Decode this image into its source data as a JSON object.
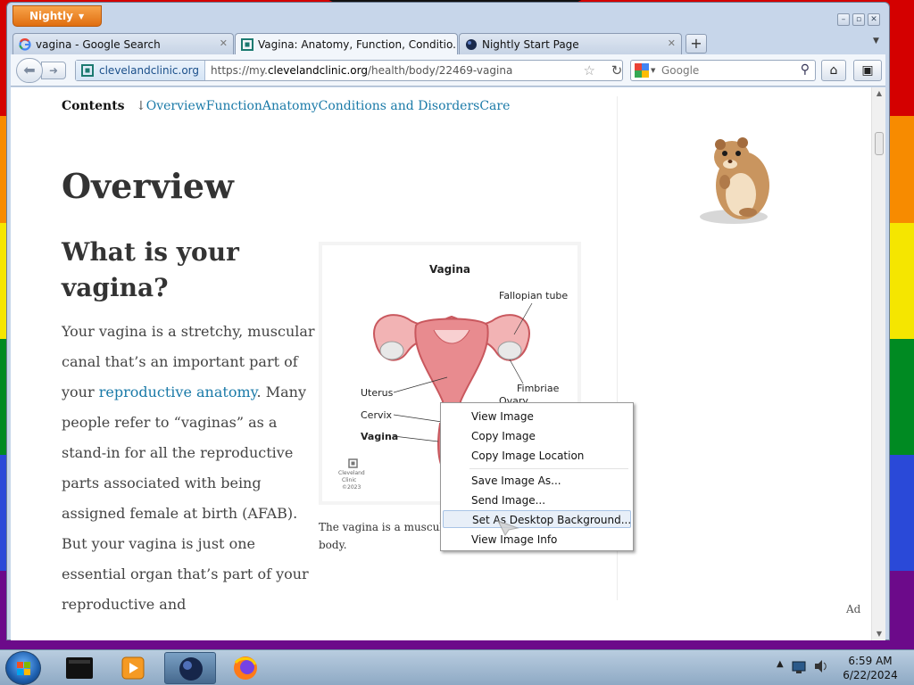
{
  "app": {
    "menu_button": "Nightly"
  },
  "tabs": [
    {
      "label": "vagina - Google Search",
      "close": "✕"
    },
    {
      "label": "Vagina: Anatomy, Function, Conditio...",
      "close": "✕"
    },
    {
      "label": "Nightly Start Page",
      "close": "✕"
    }
  ],
  "newtab_label": "+",
  "navbar": {
    "identity": "clevelandclinic.org",
    "url_prefix": "https://my.",
    "url_host": "clevelandclinic.org",
    "url_path": "/health/body/22469-vagina",
    "search_placeholder": "Google"
  },
  "page": {
    "contents_label": "Contents",
    "contents_arrow": "↓",
    "contents_links": [
      "Overview",
      "Function",
      "Anatomy",
      "Conditions and Disorders",
      "Care"
    ],
    "h1": "Overview",
    "h2": "What is your vagina?",
    "para_before": "Your vagina is a stretchy, muscular canal that’s an important part of your ",
    "para_link": "reproductive anatomy",
    "para_after": ". Many people refer to “vaginas” as a stand-in for all the reproductive parts associated with being assigned female at birth (AFAB). But your vagina is just one essential organ that’s part of your reproductive and",
    "figure": {
      "title": "Vagina",
      "labels": {
        "fallopian": "Fallopian tube",
        "fimbriae": "Fimbriae",
        "ovary": "Ovary",
        "uterus": "Uterus",
        "cervix": "Cervix",
        "vagina": "Vagina",
        "logo_line1": "Cleveland",
        "logo_line2": "Clinic",
        "logo_line3": "©2023"
      }
    },
    "caption": "The vagina is a muscular p",
    "caption_line2": "body.",
    "ad_label": "Ad"
  },
  "context_menu": [
    "View Image",
    "Copy Image",
    "Copy Image Location",
    "Save Image As...",
    "Send Image...",
    "Set As Desktop Background...",
    "View Image Info"
  ],
  "taskbar": {
    "time": "6:59 AM",
    "date": "6/22/2024"
  },
  "colors": {
    "accent_link": "#1a7aa8",
    "nightly_orange": "#e06e10",
    "uterus_pink": "#e88b8f"
  }
}
